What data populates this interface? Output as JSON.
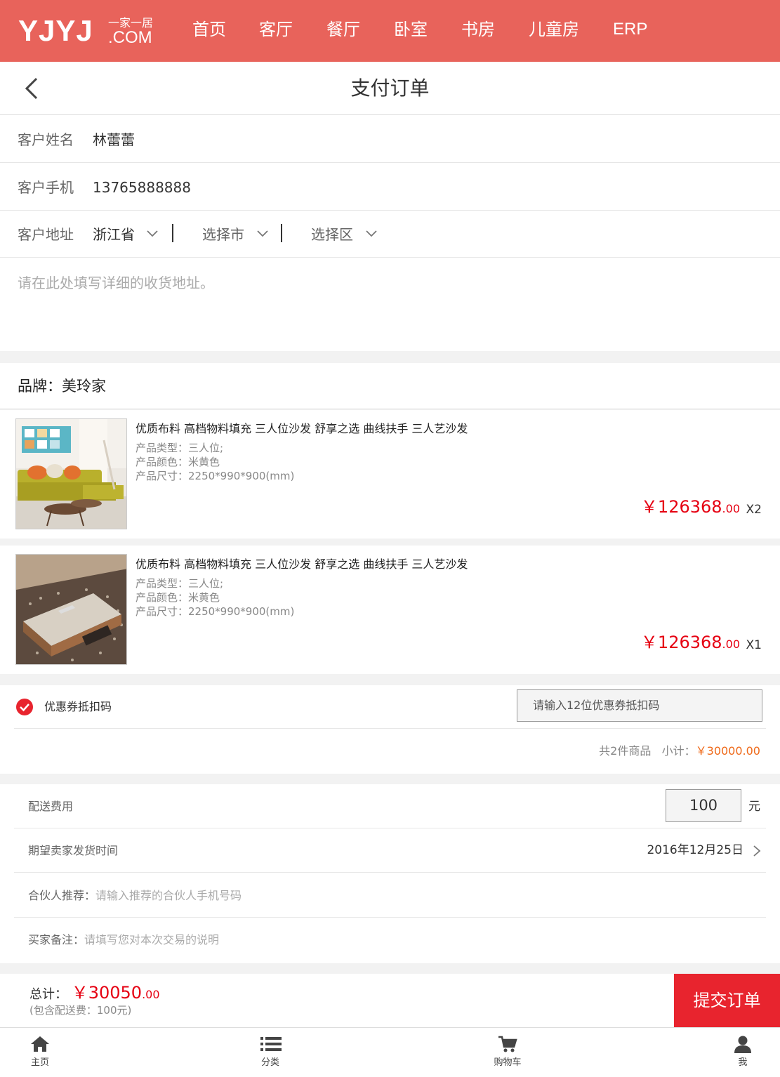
{
  "nav": {
    "logo_main": "YJYJ",
    "logo_sub": "一家一居",
    "logo_com": ".COM",
    "items": [
      "首页",
      "客厅",
      "餐厅",
      "卧室",
      "书房",
      "儿童房",
      "ERP"
    ]
  },
  "header": {
    "title": "支付订单"
  },
  "customer": {
    "name_label": "客户姓名",
    "name_value": "林蕾蕾",
    "phone_label": "客户手机",
    "phone_value": "13765888888",
    "address_label": "客户地址",
    "province": "浙江省",
    "city": "选择市",
    "district": "选择区",
    "address_placeholder": "请在此处填写详细的收货地址。"
  },
  "brand": {
    "label": "品牌：美玲家"
  },
  "products": [
    {
      "name": "优质布料 高档物料填充 三人位沙发 舒享之选 曲线扶手 三人艺沙发",
      "type": "产品类型：三人位;",
      "color": "产品颜色：米黄色",
      "size": "产品尺寸：2250*990*900(mm)",
      "price_int": "￥126368",
      "price_dec": ".00",
      "qty": "X2"
    },
    {
      "name": "优质布料 高档物料填充 三人位沙发 舒享之选 曲线扶手 三人艺沙发",
      "type": "产品类型：三人位;",
      "color": "产品颜色：米黄色",
      "size": "产品尺寸：2250*990*900(mm)",
      "price_int": "￥126368",
      "price_dec": ".00",
      "qty": "X1"
    }
  ],
  "coupon": {
    "label": "优惠券抵扣码",
    "placeholder": "请输入12位优惠券抵扣码",
    "checked": true,
    "count_text": "共2件商品",
    "subtotal_label": "小计：",
    "subtotal_amount": "￥30000.00"
  },
  "delivery": {
    "fee_label": "配送费用",
    "fee_value": "100",
    "fee_unit": "元",
    "ship_time_label": "期望卖家发货时间",
    "ship_time_value": "2016年12月25日",
    "partner_label": "合伙人推荐：",
    "partner_placeholder": "请输入推荐的合伙人手机号码",
    "remark_label": "买家备注：",
    "remark_placeholder": "请填写您对本次交易的说明"
  },
  "total": {
    "label": "总计：",
    "amount_int": "￥30050",
    "amount_dec": ".00",
    "sub": "(包含配送费：100元)",
    "submit": "提交订单"
  },
  "tabbar": {
    "items": [
      "主页",
      "分类",
      "购物车",
      "我"
    ]
  },
  "colors": {
    "brand": "#e8635b",
    "price": "#e60012",
    "submit": "#e8242e",
    "subtotal": "#ef6a1a"
  }
}
